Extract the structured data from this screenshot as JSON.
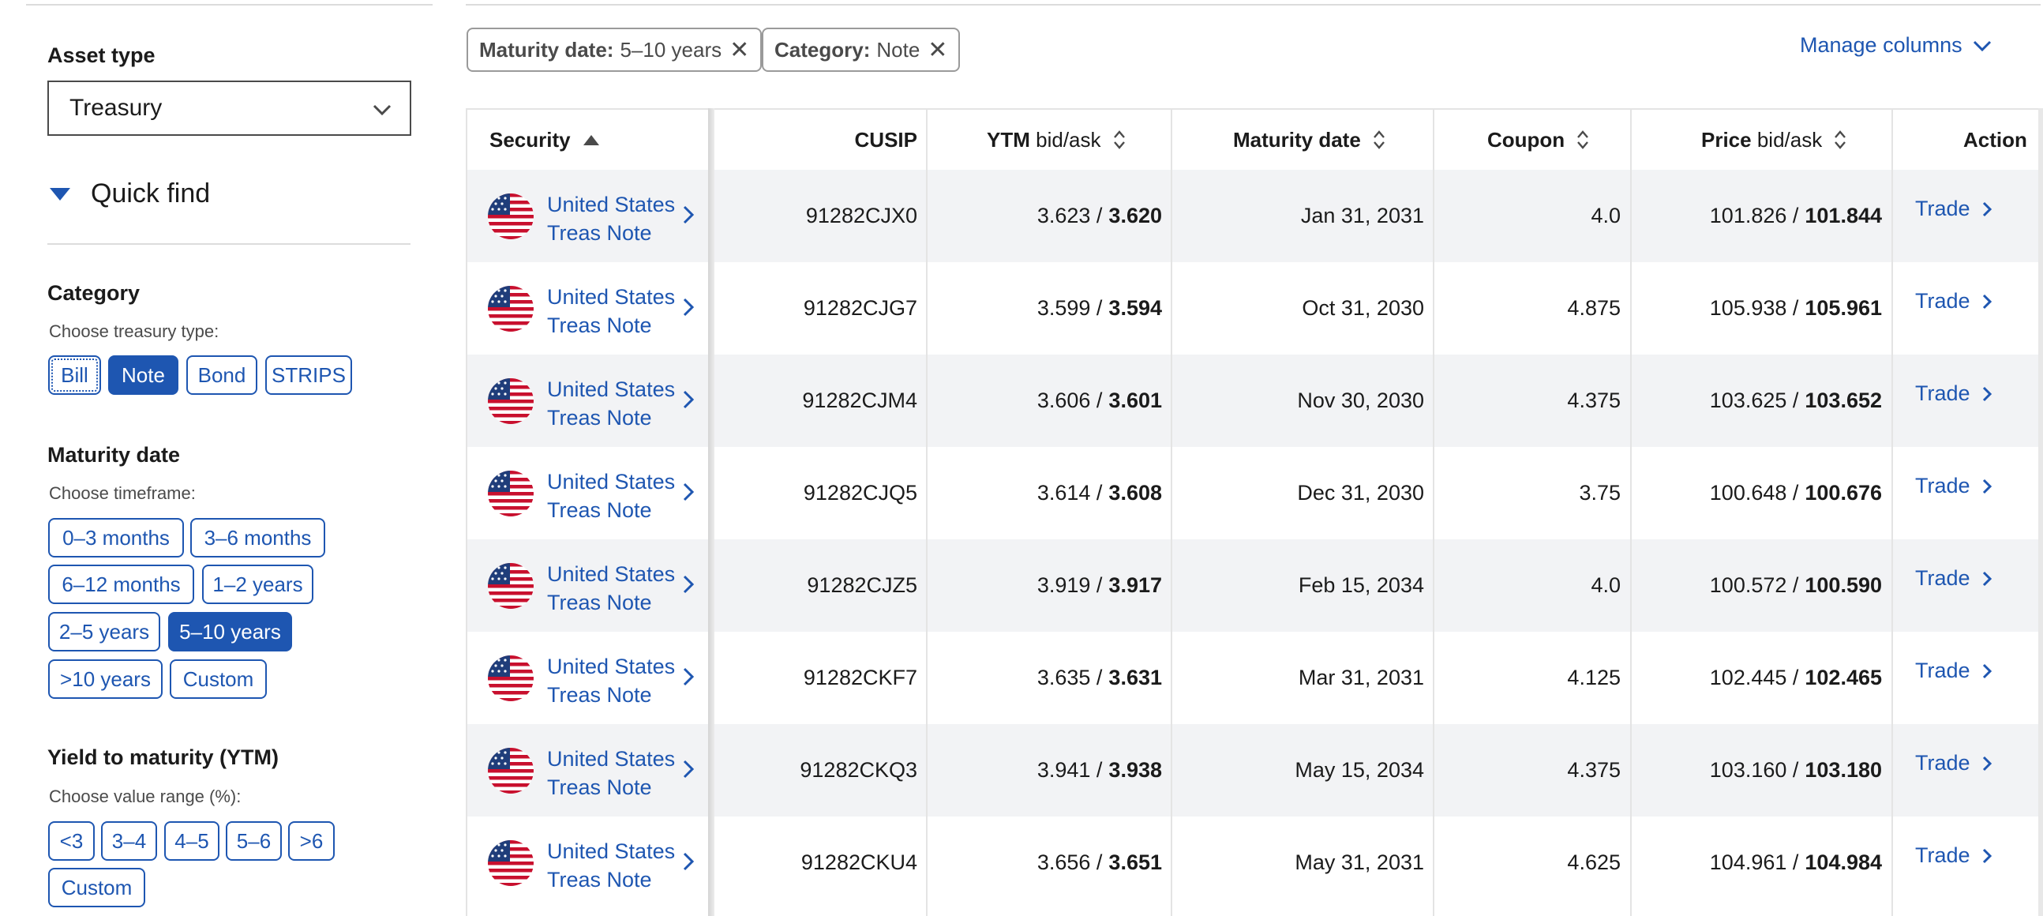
{
  "sidebar": {
    "asset_type_label": "Asset type",
    "asset_type_value": "Treasury",
    "quick_find_label": "Quick find",
    "category": {
      "label": "Category",
      "hint": "Choose treasury type:",
      "options": [
        "Bill",
        "Note",
        "Bond",
        "STRIPS"
      ],
      "selected": "Note"
    },
    "maturity": {
      "label": "Maturity date",
      "hint": "Choose timeframe:",
      "options": [
        "0–3 months",
        "3–6 months",
        "6–12 months",
        "1–2 years",
        "2–5 years",
        "5–10 years",
        ">10 years",
        "Custom"
      ],
      "selected": "5–10 years"
    },
    "ytm": {
      "label": "Yield to maturity (YTM)",
      "hint": "Choose value range (%):",
      "options": [
        "<3",
        "3–4",
        "4–5",
        "5–6",
        ">6",
        "Custom"
      ]
    }
  },
  "filters": [
    {
      "key": "Maturity date:",
      "value": "5–10 years"
    },
    {
      "key": "Category:",
      "value": "Note"
    }
  ],
  "manage_columns_label": "Manage columns",
  "table": {
    "headers": {
      "security": "Security",
      "cusip": "CUSIP",
      "ytm_bold": "YTM",
      "ytm_light": "bid/ask",
      "maturity": "Maturity date",
      "coupon": "Coupon",
      "price_bold": "Price",
      "price_light": "bid/ask",
      "action": "Action"
    },
    "rows": [
      {
        "name1": "United States",
        "name2": "Treas Note",
        "cusip": "91282CJX0",
        "ytm_bid": "3.623 /",
        "ytm_ask": "3.620",
        "maturity": "Jan 31, 2031",
        "coupon": "4.0",
        "price_bid": "101.826 /",
        "price_ask": "101.844",
        "action": "Trade"
      },
      {
        "name1": "United States",
        "name2": "Treas Note",
        "cusip": "91282CJG7",
        "ytm_bid": "3.599 /",
        "ytm_ask": "3.594",
        "maturity": "Oct 31, 2030",
        "coupon": "4.875",
        "price_bid": "105.938 /",
        "price_ask": "105.961",
        "action": "Trade"
      },
      {
        "name1": "United States",
        "name2": "Treas Note",
        "cusip": "91282CJM4",
        "ytm_bid": "3.606 /",
        "ytm_ask": "3.601",
        "maturity": "Nov 30, 2030",
        "coupon": "4.375",
        "price_bid": "103.625 /",
        "price_ask": "103.652",
        "action": "Trade"
      },
      {
        "name1": "United States",
        "name2": "Treas Note",
        "cusip": "91282CJQ5",
        "ytm_bid": "3.614 /",
        "ytm_ask": "3.608",
        "maturity": "Dec 31, 2030",
        "coupon": "3.75",
        "price_bid": "100.648 /",
        "price_ask": "100.676",
        "action": "Trade"
      },
      {
        "name1": "United States",
        "name2": "Treas Note",
        "cusip": "91282CJZ5",
        "ytm_bid": "3.919 /",
        "ytm_ask": "3.917",
        "maturity": "Feb 15, 2034",
        "coupon": "4.0",
        "price_bid": "100.572 /",
        "price_ask": "100.590",
        "action": "Trade"
      },
      {
        "name1": "United States",
        "name2": "Treas Note",
        "cusip": "91282CKF7",
        "ytm_bid": "3.635 /",
        "ytm_ask": "3.631",
        "maturity": "Mar 31, 2031",
        "coupon": "4.125",
        "price_bid": "102.445 /",
        "price_ask": "102.465",
        "action": "Trade"
      },
      {
        "name1": "United States",
        "name2": "Treas Note",
        "cusip": "91282CKQ3",
        "ytm_bid": "3.941 /",
        "ytm_ask": "3.938",
        "maturity": "May 15, 2034",
        "coupon": "4.375",
        "price_bid": "103.160 /",
        "price_ask": "103.180",
        "action": "Trade"
      },
      {
        "name1": "United States",
        "name2": "Treas Note",
        "cusip": "91282CKU4",
        "ytm_bid": "3.656 /",
        "ytm_ask": "3.651",
        "maturity": "May 31, 2031",
        "coupon": "4.625",
        "price_bid": "104.961 /",
        "price_ask": "104.984",
        "action": "Trade"
      }
    ]
  },
  "colors": {
    "accent": "#1e56b1",
    "row_alt": "#f2f3f5",
    "flag_red": "#c8102e",
    "flag_blue": "#1f3d7a"
  },
  "icons": {
    "asset_select": "chevron-down-icon",
    "quick_find": "caret-down-icon",
    "filter_remove": "close-icon",
    "security_link": "chevron-right-icon",
    "sort": "sort-arrows-icon",
    "flag": "us-flag-icon"
  }
}
